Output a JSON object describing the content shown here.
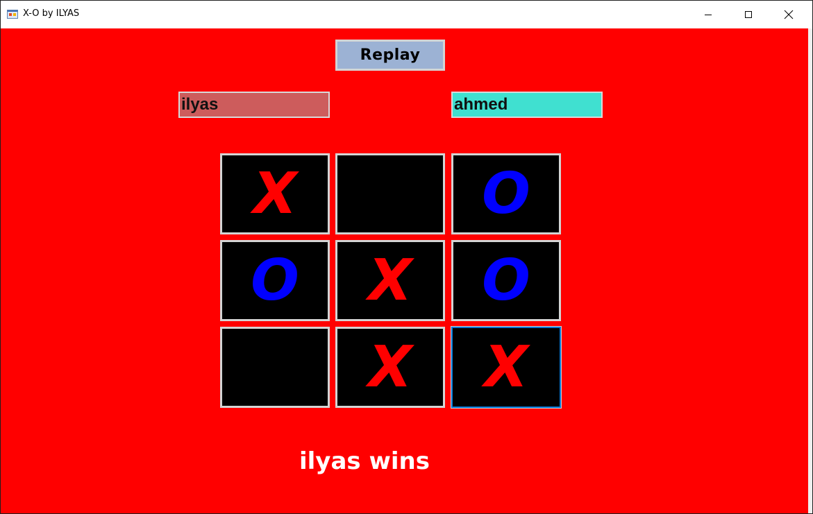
{
  "window": {
    "title": "X-O by ILYAS"
  },
  "controls": {
    "replay_label": "Replay"
  },
  "players": {
    "player1": {
      "name": "ilyas",
      "color": "#cd5c5c"
    },
    "player2": {
      "name": "ahmed",
      "color": "#40e0d0"
    }
  },
  "colors": {
    "background": "#ff0000",
    "cell_background": "#000000",
    "x_color": "#ff0000",
    "o_color": "#0000ff",
    "result_color": "#ffffff"
  },
  "board": {
    "cells": [
      "X",
      "",
      "O",
      "O",
      "X",
      "O",
      "",
      "X",
      "X"
    ],
    "focused_cell": 9
  },
  "status": {
    "result": "ilyas wins"
  }
}
